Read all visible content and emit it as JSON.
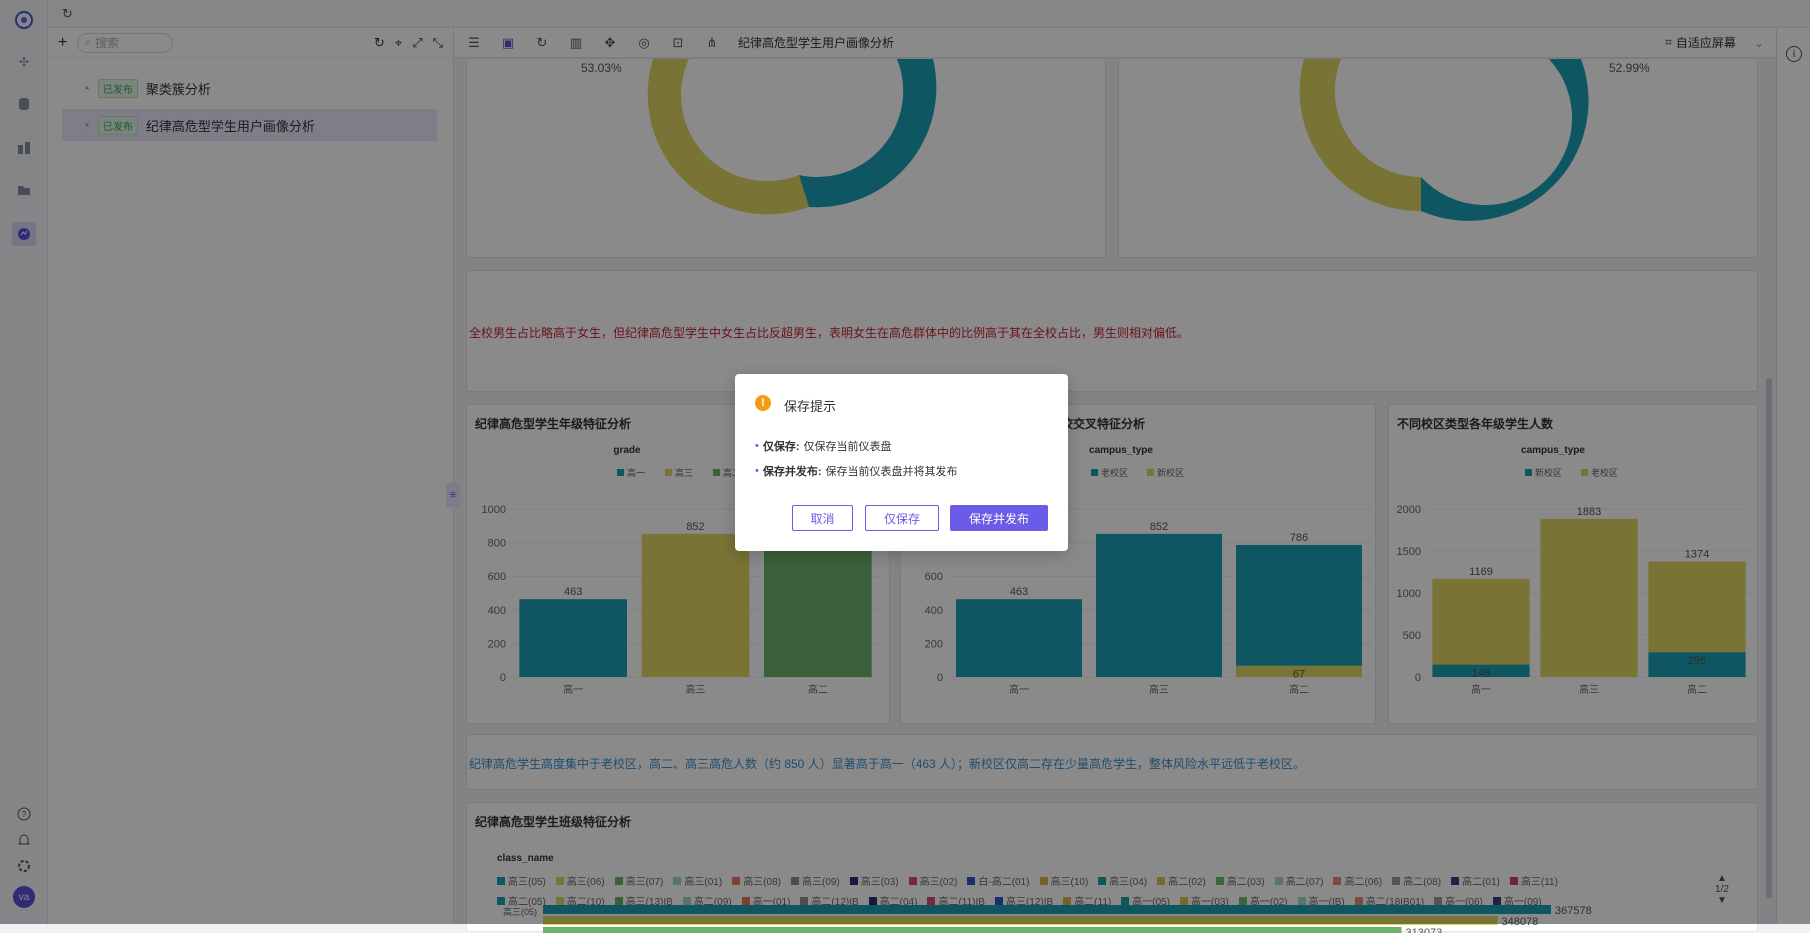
{
  "rail": {
    "avatar": "va"
  },
  "tree": {
    "search_placeholder": "搜索",
    "items": [
      {
        "badge": "已发布",
        "label": "聚类簇分析"
      },
      {
        "badge": "已发布",
        "label": "纪律高危型学生用户画像分析"
      }
    ]
  },
  "toolbar": {
    "title": "纪律高危型学生用户画像分析",
    "fit_label": "自适应屏幕"
  },
  "donuts": {
    "left_pct": "53.03%",
    "right_pct": "52.99%"
  },
  "notes": {
    "gender": "全校男生占比略高于女生，但纪律高危型学生中女生占比反超男生，表明女生在高危群体中的比例高于其在全校占比，男生则相对偏低。",
    "campus": "纪律高危学生高度集中于老校区，高二、高三高危人数（约 850 人）显著高于高一（463 人）；新校区仅高二存在少量高危学生，整体风险水平远低于老校区。"
  },
  "cards": {
    "grade": {
      "title": "纪律高危型学生年级特征分析",
      "subtitle": "grade",
      "legend": [
        "高一",
        "高三",
        "高二"
      ]
    },
    "cross": {
      "title": "纪律高危型学生年级与校区交叉特征分析",
      "title_visible": "校交叉特征分析",
      "subtitle": "campus_type",
      "legend": [
        "老校区",
        "新校区"
      ]
    },
    "campus": {
      "title": "不同校区类型各年级学生人数",
      "subtitle": "campus_type",
      "legend": [
        "新校区",
        "老校区"
      ]
    },
    "class": {
      "title": "纪律高危型学生班级特征分析",
      "subtitle": "class_name",
      "legend_row1": [
        "高三(05)",
        "高三(06)",
        "高三(07)",
        "高三(01)",
        "高三(08)",
        "高三(09)",
        "高三(03)",
        "高三(02)",
        "白-高二(01)",
        "高三(10)",
        "高三(04)",
        "高二(02)",
        "高二(03)",
        "高二(07)",
        "高二(06)",
        "高二(08)",
        "高二(01)",
        "高三(11)"
      ],
      "legend_row2": [
        "高二(05)",
        "高二(10)",
        "高三(13)IB",
        "高二(09)",
        "高一(01)",
        "高二(12)IB",
        "高二(04)",
        "高二(11)IB",
        "高三(12)IB",
        "高二(11)",
        "高一(05)",
        "高一(03)",
        "高一(02)",
        "高一(IB)",
        "高二(18IB01)",
        "高一(06)",
        "高一(09)"
      ],
      "page": "1/2",
      "bar_values": [
        367578,
        348078,
        313073
      ],
      "row_label": "高三(05)"
    }
  },
  "chart_data": [
    {
      "type": "bar",
      "title": "纪律高危型学生年级特征分析",
      "series_label": "grade",
      "categories": [
        "高一",
        "高三",
        "高二"
      ],
      "values": [
        463,
        852,
        786
      ],
      "ylim": [
        0,
        1000
      ],
      "yticks": [
        0,
        200,
        400,
        600,
        800,
        1000
      ]
    },
    {
      "type": "bar",
      "title": "纪律高危型学生年级与校区交叉特征分析",
      "series_label": "campus_type",
      "categories": [
        "高一",
        "高三",
        "高二"
      ],
      "series": [
        {
          "name": "老校区",
          "values": [
            463,
            852,
            719
          ]
        },
        {
          "name": "新校区",
          "values": [
            0,
            0,
            67
          ]
        }
      ],
      "totals": [
        463,
        852,
        786
      ],
      "ylim": [
        0,
        1000
      ],
      "yticks": [
        0,
        200,
        400,
        600,
        800,
        1000
      ]
    },
    {
      "type": "bar",
      "title": "不同校区类型各年级学生人数",
      "series_label": "campus_type",
      "categories": [
        "高一",
        "高三",
        "高二"
      ],
      "series": [
        {
          "name": "新校区",
          "values": [
            148,
            0,
            295
          ]
        },
        {
          "name": "老校区",
          "values": [
            1021,
            1883,
            1079
          ]
        }
      ],
      "totals": [
        1169,
        1883,
        1374
      ],
      "ylim": [
        0,
        2000
      ],
      "yticks": [
        0,
        500,
        1000,
        1500,
        2000
      ]
    }
  ],
  "dialog": {
    "title": "保存提示",
    "line1_key": "仅保存:",
    "line1_text": "仅保存当前仪表盘",
    "line2_key": "保存并发布:",
    "line2_text": "保存当前仪表盘并将其发布",
    "cancel": "取消",
    "save": "仅保存",
    "publish": "保存并发布"
  },
  "colors": {
    "teal": "#1a9fb3",
    "yellow": "#e0d462",
    "green": "#6cb26c",
    "primary": "#6b5ce7",
    "red_text": "#c8243c",
    "blue_text": "#3a8fd1"
  }
}
